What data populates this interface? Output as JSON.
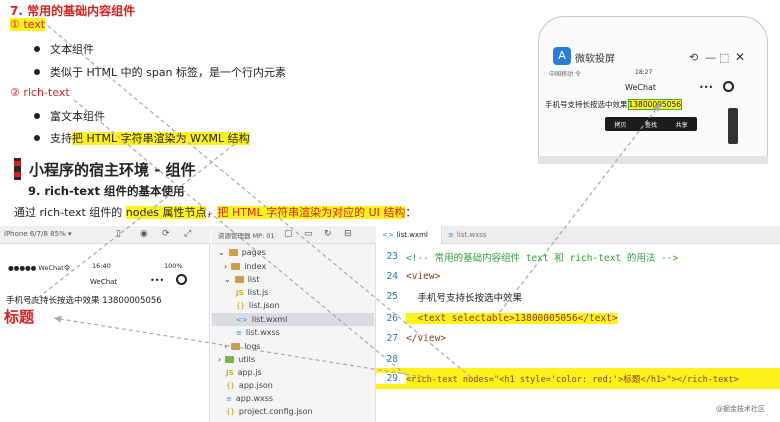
{
  "notes": {
    "section_title": "7. 常用的基础内容组件",
    "item1_label": "① text",
    "item1_points": [
      "文本组件",
      "类似于 HTML 中的 span 标签，是一个行内元素"
    ],
    "item2_label": "② rich-text",
    "item2_point1": "富文本组件",
    "item2_point2_prefix": "支持",
    "item2_point2_hl": "把 HTML 字符串渲染为 WXML 结构",
    "heading": "小程序的宿主环境 - 组件",
    "subheading": "9. rich-text 组件的基本使用",
    "desc_prefix": "通过 rich-text 组件的 ",
    "desc_hl1": "nodes 属性节点",
    "desc_mid": "，",
    "desc_hl2": "把 HTML 字符串渲染为对应的 UI 结构",
    "desc_suffix": "："
  },
  "mini_phone": {
    "app_name": "微软投屏",
    "status_left": "中国移动 令",
    "status_time": "18:27",
    "title": "WeChat",
    "content_text": "手机号支持长按选中效果",
    "phone_number": "13800005056",
    "menu": [
      "拷贝",
      "查找",
      "共享"
    ]
  },
  "simulator": {
    "device": "iPhone 6/7/8 85% ▾",
    "carrier": "●●●●● WeChat令",
    "time": "16:40",
    "battery": "100%",
    "title": "WeChat",
    "content_text": "手机号支持长按选中效果 13800005056",
    "rich_heading": "标题"
  },
  "file_tree": {
    "toolbar_label": "资源管理器  MP: 01",
    "items": [
      {
        "name": "pages",
        "kind": "folder"
      },
      {
        "name": "index",
        "kind": "folder"
      },
      {
        "name": "list",
        "kind": "folder"
      },
      {
        "name": "list.js",
        "kind": "js"
      },
      {
        "name": "list.json",
        "kind": "json"
      },
      {
        "name": "list.wxml",
        "kind": "wxml"
      },
      {
        "name": "list.wxss",
        "kind": "wxss"
      },
      {
        "name": "logs",
        "kind": "folder"
      },
      {
        "name": "utils",
        "kind": "folder"
      },
      {
        "name": "app.js",
        "kind": "js"
      },
      {
        "name": "app.json",
        "kind": "json"
      },
      {
        "name": "app.wxss",
        "kind": "wxss"
      },
      {
        "name": "project.config.json",
        "kind": "json"
      }
    ]
  },
  "editor": {
    "tabs": [
      "list.wxml",
      "list.wxss"
    ],
    "lines": [
      {
        "num": "23",
        "text": "<!-- 常用的基础内容组件 text 和 rich-text 的用法 -->"
      },
      {
        "num": "24",
        "text": "<view>"
      },
      {
        "num": "25",
        "text": "  手机号支持长按选中效果"
      },
      {
        "num": "26",
        "text": "  <text selectable>13800005056</text>"
      },
      {
        "num": "27",
        "text": "</view>"
      },
      {
        "num": "28",
        "text": ""
      },
      {
        "num": "29",
        "text": "<rich-text nodes=\"<h1 style='color: red;'>标题</h1>\"></rich-text>"
      }
    ]
  },
  "watermark": "@掘金技术社区",
  "colors": {
    "highlight": "#fff21c",
    "accent_red": "#d8201f",
    "comment_green": "#2e9d3a",
    "line_number_blue": "#2b7bb9"
  }
}
